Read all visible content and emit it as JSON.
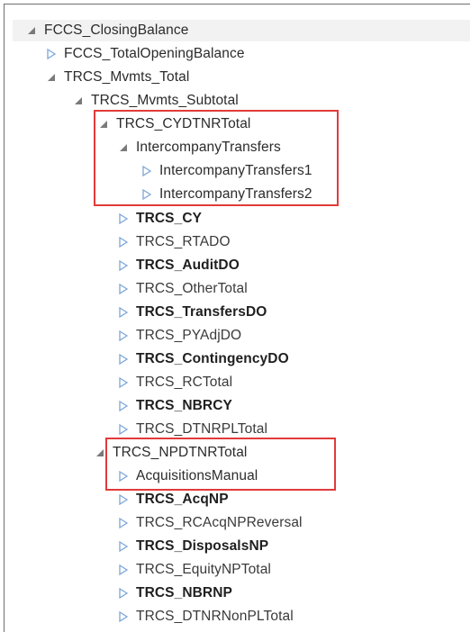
{
  "tree": [
    {
      "label": "FCCS_ClosingBalance",
      "state": "expanded"
    },
    {
      "label": "FCCS_TotalOpeningBalance",
      "state": "collapsed"
    },
    {
      "label": "TRCS_Mvmts_Total",
      "state": "expanded"
    },
    {
      "label": "TRCS_Mvmts_Subtotal",
      "state": "expanded"
    },
    {
      "label": "TRCS_CYDTNRTotal",
      "state": "expanded"
    },
    {
      "label": "IntercompanyTransfers",
      "state": "expanded"
    },
    {
      "label": "IntercompanyTransfers1",
      "state": "collapsed"
    },
    {
      "label": "IntercompanyTransfers2",
      "state": "collapsed"
    },
    {
      "label": "TRCS_CY",
      "state": "collapsed"
    },
    {
      "label": "TRCS_RTADO",
      "state": "collapsed"
    },
    {
      "label": "TRCS_AuditDO",
      "state": "collapsed"
    },
    {
      "label": "TRCS_OtherTotal",
      "state": "collapsed"
    },
    {
      "label": "TRCS_TransfersDO",
      "state": "collapsed"
    },
    {
      "label": "TRCS_PYAdjDO",
      "state": "collapsed"
    },
    {
      "label": "TRCS_ContingencyDO",
      "state": "collapsed"
    },
    {
      "label": "TRCS_RCTotal",
      "state": "collapsed"
    },
    {
      "label": "TRCS_NBRCY",
      "state": "collapsed"
    },
    {
      "label": "TRCS_DTNRPLTotal",
      "state": "collapsed"
    },
    {
      "label": "TRCS_NPDTNRTotal",
      "state": "expanded"
    },
    {
      "label": "AcquisitionsManual",
      "state": "collapsed"
    },
    {
      "label": "TRCS_AcqNP",
      "state": "collapsed"
    },
    {
      "label": "TRCS_RCAcqNPReversal",
      "state": "collapsed"
    },
    {
      "label": "TRCS_DisposalsNP",
      "state": "collapsed"
    },
    {
      "label": "TRCS_EquityNPTotal",
      "state": "collapsed"
    },
    {
      "label": "TRCS_NBRNP",
      "state": "collapsed"
    },
    {
      "label": "TRCS_DTNRNonPLTotal",
      "state": "collapsed"
    }
  ],
  "colors": {
    "highlight": "#e23a3a",
    "expander_collapsed": "#7ea6d6",
    "expander_expanded": "#7a7a7a",
    "text": "#2b2b2b"
  }
}
